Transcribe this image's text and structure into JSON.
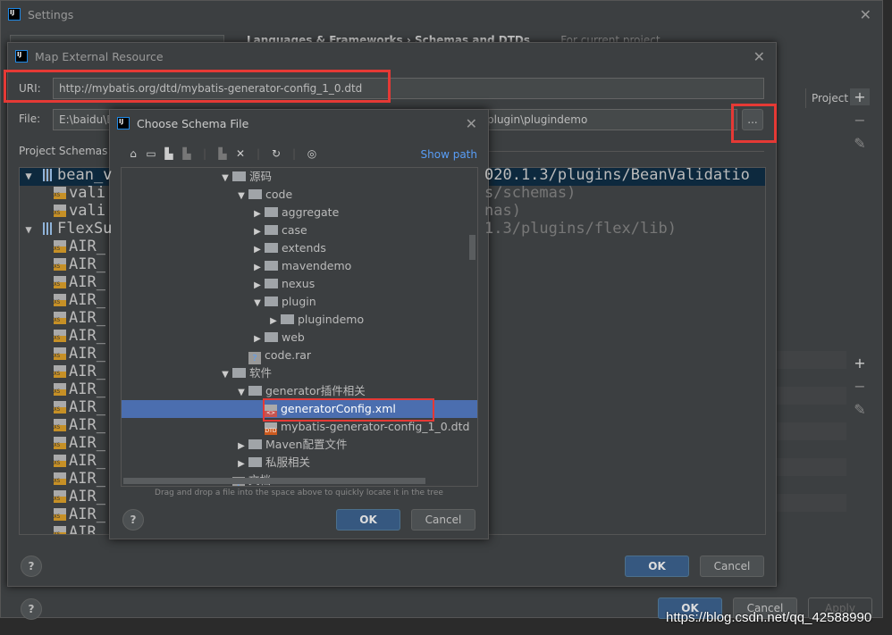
{
  "settings": {
    "title": "Settings",
    "breadcrumb": [
      "Languages & Frameworks",
      "Schemas and DTDs"
    ],
    "scope": "For current project",
    "column": "Project",
    "ok": "OK",
    "cancel": "Cancel",
    "apply": "Apply"
  },
  "map": {
    "title": "Map External Resource",
    "uri_label": "URI:",
    "uri": "http://mybatis.org/dtd/mybatis-generator-config_1_0.dtd",
    "file_label": "File:",
    "file_left": "E:\\baidu\\E",
    "file_right": "plugin\\plugindemo",
    "browse": "...",
    "schemas_label": "Project Schemas",
    "schemas": [
      {
        "name": "bean_v",
        "type": "lib",
        "expanded": true
      },
      {
        "name": "vali",
        "type": "xs"
      },
      {
        "name": "vali",
        "type": "xs"
      },
      {
        "name": "FlexSu",
        "type": "lib",
        "expanded": true
      },
      {
        "name": "AIR_",
        "type": "xs"
      },
      {
        "name": "AIR_",
        "type": "xs"
      },
      {
        "name": "AIR_",
        "type": "xs"
      },
      {
        "name": "AIR_",
        "type": "xs"
      },
      {
        "name": "AIR_",
        "type": "xs"
      },
      {
        "name": "AIR_",
        "type": "xs"
      },
      {
        "name": "AIR_",
        "type": "xs"
      },
      {
        "name": "AIR_",
        "type": "xs"
      },
      {
        "name": "AIR_",
        "type": "xs"
      },
      {
        "name": "AIR_",
        "type": "xs"
      },
      {
        "name": "AIR_",
        "type": "xs"
      },
      {
        "name": "AIR_",
        "type": "xs"
      },
      {
        "name": "AIR_",
        "type": "xs"
      },
      {
        "name": "AIR_",
        "type": "xs"
      },
      {
        "name": "AIR_",
        "type": "xs"
      },
      {
        "name": "AIR_",
        "type": "xs"
      },
      {
        "name": "AIR",
        "type": "xs"
      }
    ],
    "paths": [
      "020.1.3/plugins/BeanValidatio",
      "s/schemas)",
      "nas)",
      "1.3/plugins/flex/lib)"
    ],
    "ok": "OK",
    "cancel": "Cancel"
  },
  "chooser": {
    "title": "Choose Schema File",
    "show_path": "Show path",
    "hint": "Drag and drop a file into the space above to quickly locate it in the tree",
    "ok": "OK",
    "cancel": "Cancel",
    "toolbar": [
      "home-icon",
      "desktop-icon",
      "project-folder-icon",
      "module-folder-icon",
      "new-folder-icon",
      "delete-icon",
      "refresh-icon",
      "hidden-files-icon"
    ],
    "tree": [
      {
        "label": "源码",
        "depth": 0,
        "kind": "folder",
        "state": "open"
      },
      {
        "label": "code",
        "depth": 1,
        "kind": "folder",
        "state": "open"
      },
      {
        "label": "aggregate",
        "depth": 2,
        "kind": "folder",
        "state": "closed"
      },
      {
        "label": "case",
        "depth": 2,
        "kind": "folder",
        "state": "closed"
      },
      {
        "label": "extends",
        "depth": 2,
        "kind": "folder",
        "state": "closed"
      },
      {
        "label": "mavendemo",
        "depth": 2,
        "kind": "folder",
        "state": "closed"
      },
      {
        "label": "nexus",
        "depth": 2,
        "kind": "folder",
        "state": "closed"
      },
      {
        "label": "plugin",
        "depth": 2,
        "kind": "folder",
        "state": "open"
      },
      {
        "label": "plugindemo",
        "depth": 3,
        "kind": "folder",
        "state": "closed"
      },
      {
        "label": "web",
        "depth": 2,
        "kind": "folder",
        "state": "closed"
      },
      {
        "label": "code.rar",
        "depth": 1,
        "kind": "unknown",
        "state": "none"
      },
      {
        "label": "软件",
        "depth": 0,
        "kind": "folder",
        "state": "open"
      },
      {
        "label": "generator插件相关",
        "depth": 1,
        "kind": "folder",
        "state": "open"
      },
      {
        "label": "generatorConfig.xml",
        "depth": 2,
        "kind": "xml",
        "state": "none",
        "selected": true
      },
      {
        "label": "mybatis-generator-config_1_0.dtd",
        "depth": 2,
        "kind": "dtd",
        "state": "none"
      },
      {
        "label": "Maven配置文件",
        "depth": 1,
        "kind": "folder",
        "state": "closed"
      },
      {
        "label": "私服相关",
        "depth": 1,
        "kind": "folder",
        "state": "closed"
      },
      {
        "label": "文档.rar",
        "depth": 0,
        "kind": "unknown",
        "state": "none"
      }
    ]
  },
  "watermark": "https://blog.csdn.net/qq_42588990",
  "colors": {
    "selection": "#4b6eaf",
    "highlight": "#e53935",
    "link": "#589df6"
  }
}
